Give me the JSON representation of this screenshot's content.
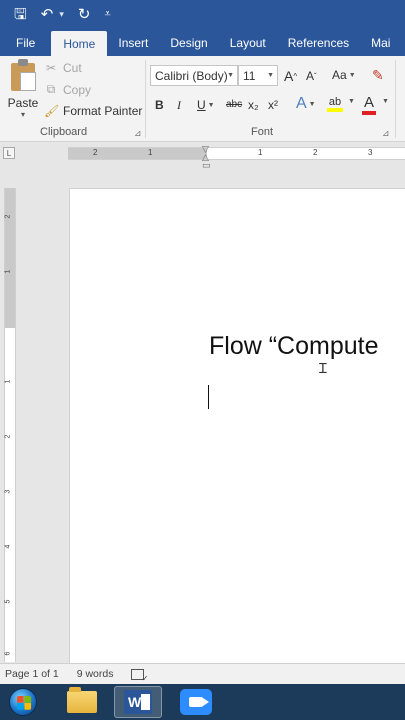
{
  "qat": {
    "save": "🖫",
    "undo": "↶",
    "undo_dropdown": "▾",
    "redo": "↻",
    "customize": "⩡"
  },
  "tabs": [
    {
      "label": "File",
      "active": false
    },
    {
      "label": "Home",
      "active": true
    },
    {
      "label": "Insert",
      "active": false
    },
    {
      "label": "Design",
      "active": false
    },
    {
      "label": "Layout",
      "active": false
    },
    {
      "label": "References",
      "active": false
    },
    {
      "label": "Mai",
      "active": false
    }
  ],
  "clipboard": {
    "paste_label": "Paste",
    "cut_label": "Cut",
    "copy_label": "Copy",
    "format_painter_label": "Format Painter",
    "group_label": "Clipboard"
  },
  "font": {
    "font_name": "Calibri (Body)",
    "font_size": "11",
    "group_label": "Font",
    "grow": "A",
    "shrink": "A",
    "change_case": "Aa",
    "bold": "B",
    "italic": "I",
    "underline": "U",
    "strikethrough": "abc",
    "subscript": "x₂",
    "superscript": "x²",
    "text_effects": "A",
    "font_color": "A",
    "highlight_color": "#ffff00",
    "font_color_value": "#e02020"
  },
  "ruler": {
    "tab_selector": "L",
    "h_labels": [
      "2",
      "1",
      "1",
      "2",
      "3"
    ],
    "v_labels": [
      "2",
      "1",
      "1",
      "2",
      "3",
      "4",
      "5",
      "6"
    ]
  },
  "document": {
    "text": "Flow “Compute"
  },
  "status": {
    "page": "Page 1 of 1",
    "words": "9 words"
  },
  "colors": {
    "word_blue": "#2b579a",
    "taskbar": "#1c3a5a"
  }
}
